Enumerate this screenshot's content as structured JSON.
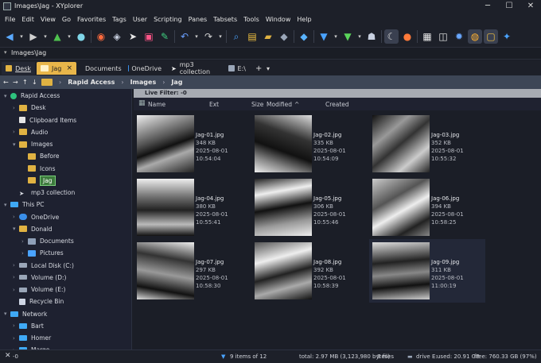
{
  "window": {
    "title": "Images\\Jag - XYplorer",
    "min": "─",
    "max": "☐",
    "close": "✕"
  },
  "menu": [
    "File",
    "Edit",
    "View",
    "Go",
    "Favorites",
    "Tags",
    "User",
    "Scripting",
    "Panes",
    "Tabsets",
    "Tools",
    "Window",
    "Help"
  ],
  "address": {
    "path": "Images\\Jag"
  },
  "tabs": [
    {
      "label": "Desk",
      "state": "dim"
    },
    {
      "label": "Jag",
      "state": "active"
    },
    {
      "label": "Documents",
      "state": "normal"
    },
    {
      "label": "OneDrive",
      "state": "normal"
    },
    {
      "label": "mp3 collection",
      "state": "normal"
    },
    {
      "label": "E:\\",
      "state": "normal"
    }
  ],
  "tab_controls": {
    "close": "×",
    "add": "+",
    "menu": "▾"
  },
  "breadcrumb": [
    "Rapid Access",
    "Images",
    "Jag"
  ],
  "breadcrumb_sep": "›",
  "tree": [
    {
      "label": "Rapid Access",
      "level": 0,
      "exp": "▾",
      "icon": "rapid"
    },
    {
      "label": "Desk",
      "level": 1,
      "exp": "›",
      "icon": "folder"
    },
    {
      "label": "Clipboard Items",
      "level": 1,
      "exp": "",
      "icon": "clip"
    },
    {
      "label": "Audio",
      "level": 1,
      "exp": "›",
      "icon": "folder"
    },
    {
      "label": "Images",
      "level": 1,
      "exp": "▾",
      "icon": "folder"
    },
    {
      "label": "Before",
      "level": 2,
      "exp": "",
      "icon": "folder"
    },
    {
      "label": "Icons",
      "level": 2,
      "exp": "",
      "icon": "folder"
    },
    {
      "label": "Jag",
      "level": 2,
      "exp": "",
      "icon": "folder",
      "selected": true
    },
    {
      "label": "mp3 collection",
      "level": 1,
      "exp": "",
      "icon": "mp3"
    },
    {
      "label": "This PC",
      "level": 0,
      "exp": "▾",
      "icon": "pc"
    },
    {
      "label": "OneDrive",
      "level": 1,
      "exp": "›",
      "icon": "cloud"
    },
    {
      "label": "Donald",
      "level": 1,
      "exp": "▾",
      "icon": "folder"
    },
    {
      "label": "Documents",
      "level": 2,
      "exp": "›",
      "icon": "docs"
    },
    {
      "label": "Pictures",
      "level": 2,
      "exp": "›",
      "icon": "pics"
    },
    {
      "label": "Local Disk (C:)",
      "level": 1,
      "exp": "›",
      "icon": "drive"
    },
    {
      "label": "Volume (D:)",
      "level": 1,
      "exp": "›",
      "icon": "drive"
    },
    {
      "label": "Volume (E:)",
      "level": 1,
      "exp": "›",
      "icon": "drive"
    },
    {
      "label": "Recycle Bin",
      "level": 1,
      "exp": "",
      "icon": "bin"
    },
    {
      "label": "Network",
      "level": 0,
      "exp": "▾",
      "icon": "net"
    },
    {
      "label": "Bart",
      "level": 1,
      "exp": "›",
      "icon": "pc"
    },
    {
      "label": "Homer",
      "level": 1,
      "exp": "›",
      "icon": "pc"
    },
    {
      "label": "Marge",
      "level": 1,
      "exp": "›",
      "icon": "pc"
    }
  ],
  "live_filter": {
    "label": "Live Filter: -0"
  },
  "columns": {
    "name": "Name",
    "ext": "Ext",
    "size": "Size",
    "modified": "Modified",
    "created": "Created",
    "sort_arrow": "^",
    "sort_arrow2": "^"
  },
  "files": [
    {
      "name": "Jag-01.jpg",
      "size": "348 KB",
      "date": "2025-08-01 10:54:04"
    },
    {
      "name": "Jag-02.jpg",
      "size": "335 KB",
      "date": "2025-08-01 10:54:09"
    },
    {
      "name": "Jag-03.jpg",
      "size": "352 KB",
      "date": "2025-08-01 10:55:32"
    },
    {
      "name": "Jag-04.jpg",
      "size": "380 KB",
      "date": "2025-08-01 10:55:41"
    },
    {
      "name": "Jag-05.jpg",
      "size": "306 KB",
      "date": "2025-08-01 10:55:46"
    },
    {
      "name": "Jag-06.jpg",
      "size": "394 KB",
      "date": "2025-08-01 10:58:25"
    },
    {
      "name": "Jag-07.jpg",
      "size": "297 KB",
      "date": "2025-08-01 10:58:30"
    },
    {
      "name": "Jag-08.jpg",
      "size": "392 KB",
      "date": "2025-08-01 10:58:39"
    },
    {
      "name": "Jag-09.jpg",
      "size": "311 KB",
      "date": "2025-08-01 11:00:19"
    }
  ],
  "status": {
    "filter_value": "-0",
    "items": "9 items of 12",
    "total": "total: 2.97 MB (3,123,980 bytes)",
    "files": "9 files",
    "drive": "drive E:",
    "used": "used: 20.91 GB",
    "free": "free: 760.33 GB (97%)"
  },
  "colors": {
    "accent": "#e8b64a",
    "folder": "#e0b242",
    "breadcrumb_bg": "#3d4656",
    "live_filter_bg": "#a7abb2"
  }
}
